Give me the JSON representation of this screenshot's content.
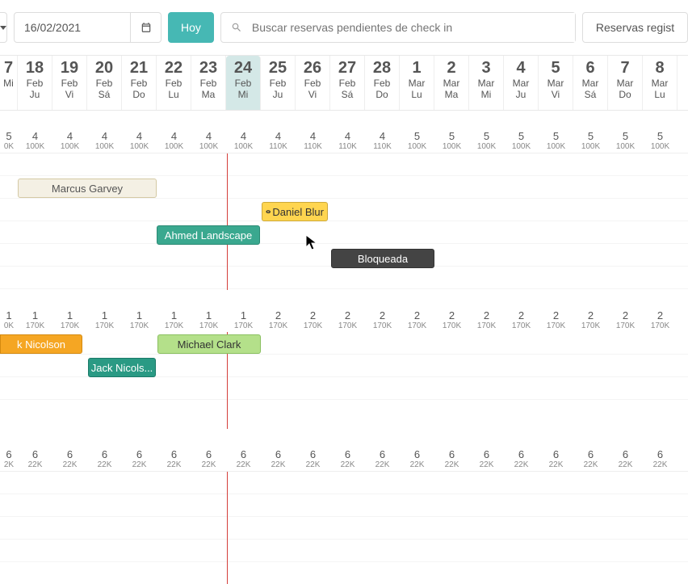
{
  "toolbar": {
    "date_value": "16/02/2021",
    "hoy_label": "Hoy",
    "search_placeholder": "Buscar reservas pendientes de check in",
    "registered_btn": "Reservas regist"
  },
  "dates": [
    {
      "day": "7",
      "month": "",
      "wd": "Mi"
    },
    {
      "day": "18",
      "month": "Feb",
      "wd": "Ju"
    },
    {
      "day": "19",
      "month": "Feb",
      "wd": "Vi"
    },
    {
      "day": "20",
      "month": "Feb",
      "wd": "Sá"
    },
    {
      "day": "21",
      "month": "Feb",
      "wd": "Do"
    },
    {
      "day": "22",
      "month": "Feb",
      "wd": "Lu"
    },
    {
      "day": "23",
      "month": "Feb",
      "wd": "Ma"
    },
    {
      "day": "24",
      "month": "Feb",
      "wd": "Mi"
    },
    {
      "day": "25",
      "month": "Feb",
      "wd": "Ju"
    },
    {
      "day": "26",
      "month": "Feb",
      "wd": "Vi"
    },
    {
      "day": "27",
      "month": "Feb",
      "wd": "Sá"
    },
    {
      "day": "28",
      "month": "Feb",
      "wd": "Do"
    },
    {
      "day": "1",
      "month": "Mar",
      "wd": "Lu"
    },
    {
      "day": "2",
      "month": "Mar",
      "wd": "Ma"
    },
    {
      "day": "3",
      "month": "Mar",
      "wd": "Mi"
    },
    {
      "day": "4",
      "month": "Mar",
      "wd": "Ju"
    },
    {
      "day": "5",
      "month": "Mar",
      "wd": "Vi"
    },
    {
      "day": "6",
      "month": "Mar",
      "wd": "Sá"
    },
    {
      "day": "7",
      "month": "Mar",
      "wd": "Do"
    },
    {
      "day": "8",
      "month": "Mar",
      "wd": "Lu"
    }
  ],
  "prices_row1": [
    {
      "v": "5",
      "c": "0K"
    },
    {
      "v": "4",
      "c": "100K"
    },
    {
      "v": "4",
      "c": "100K"
    },
    {
      "v": "4",
      "c": "100K"
    },
    {
      "v": "4",
      "c": "100K"
    },
    {
      "v": "4",
      "c": "100K"
    },
    {
      "v": "4",
      "c": "100K"
    },
    {
      "v": "4",
      "c": "100K"
    },
    {
      "v": "4",
      "c": "110K"
    },
    {
      "v": "4",
      "c": "110K"
    },
    {
      "v": "4",
      "c": "110K"
    },
    {
      "v": "4",
      "c": "110K"
    },
    {
      "v": "5",
      "c": "100K"
    },
    {
      "v": "5",
      "c": "100K"
    },
    {
      "v": "5",
      "c": "100K"
    },
    {
      "v": "5",
      "c": "100K"
    },
    {
      "v": "5",
      "c": "100K"
    },
    {
      "v": "5",
      "c": "100K"
    },
    {
      "v": "5",
      "c": "100K"
    },
    {
      "v": "5",
      "c": "100K"
    }
  ],
  "prices_row2": [
    {
      "v": "1",
      "c": "0K"
    },
    {
      "v": "1",
      "c": "170K"
    },
    {
      "v": "1",
      "c": "170K"
    },
    {
      "v": "1",
      "c": "170K"
    },
    {
      "v": "1",
      "c": "170K"
    },
    {
      "v": "1",
      "c": "170K"
    },
    {
      "v": "1",
      "c": "170K"
    },
    {
      "v": "1",
      "c": "170K"
    },
    {
      "v": "2",
      "c": "170K"
    },
    {
      "v": "2",
      "c": "170K"
    },
    {
      "v": "2",
      "c": "170K"
    },
    {
      "v": "2",
      "c": "170K"
    },
    {
      "v": "2",
      "c": "170K"
    },
    {
      "v": "2",
      "c": "170K"
    },
    {
      "v": "2",
      "c": "170K"
    },
    {
      "v": "2",
      "c": "170K"
    },
    {
      "v": "2",
      "c": "170K"
    },
    {
      "v": "2",
      "c": "170K"
    },
    {
      "v": "2",
      "c": "170K"
    },
    {
      "v": "2",
      "c": "170K"
    }
  ],
  "prices_row3": [
    {
      "v": "6",
      "c": "2K"
    },
    {
      "v": "6",
      "c": "22K"
    },
    {
      "v": "6",
      "c": "22K"
    },
    {
      "v": "6",
      "c": "22K"
    },
    {
      "v": "6",
      "c": "22K"
    },
    {
      "v": "6",
      "c": "22K"
    },
    {
      "v": "6",
      "c": "22K"
    },
    {
      "v": "6",
      "c": "22K"
    },
    {
      "v": "6",
      "c": "22K"
    },
    {
      "v": "6",
      "c": "22K"
    },
    {
      "v": "6",
      "c": "22K"
    },
    {
      "v": "6",
      "c": "22K"
    },
    {
      "v": "6",
      "c": "22K"
    },
    {
      "v": "6",
      "c": "22K"
    },
    {
      "v": "6",
      "c": "22K"
    },
    {
      "v": "6",
      "c": "22K"
    },
    {
      "v": "6",
      "c": "22K"
    },
    {
      "v": "6",
      "c": "22K"
    },
    {
      "v": "6",
      "c": "22K"
    },
    {
      "v": "6",
      "c": "22K"
    }
  ],
  "bookings": {
    "b1": "Marcus Garvey",
    "b2": "Daniel Blur",
    "b3": "Ahmed Landscape",
    "b4": "Bloqueada",
    "b5": "k Nicolson",
    "b6": "Michael Clark",
    "b7": "Jack Nicols..."
  }
}
